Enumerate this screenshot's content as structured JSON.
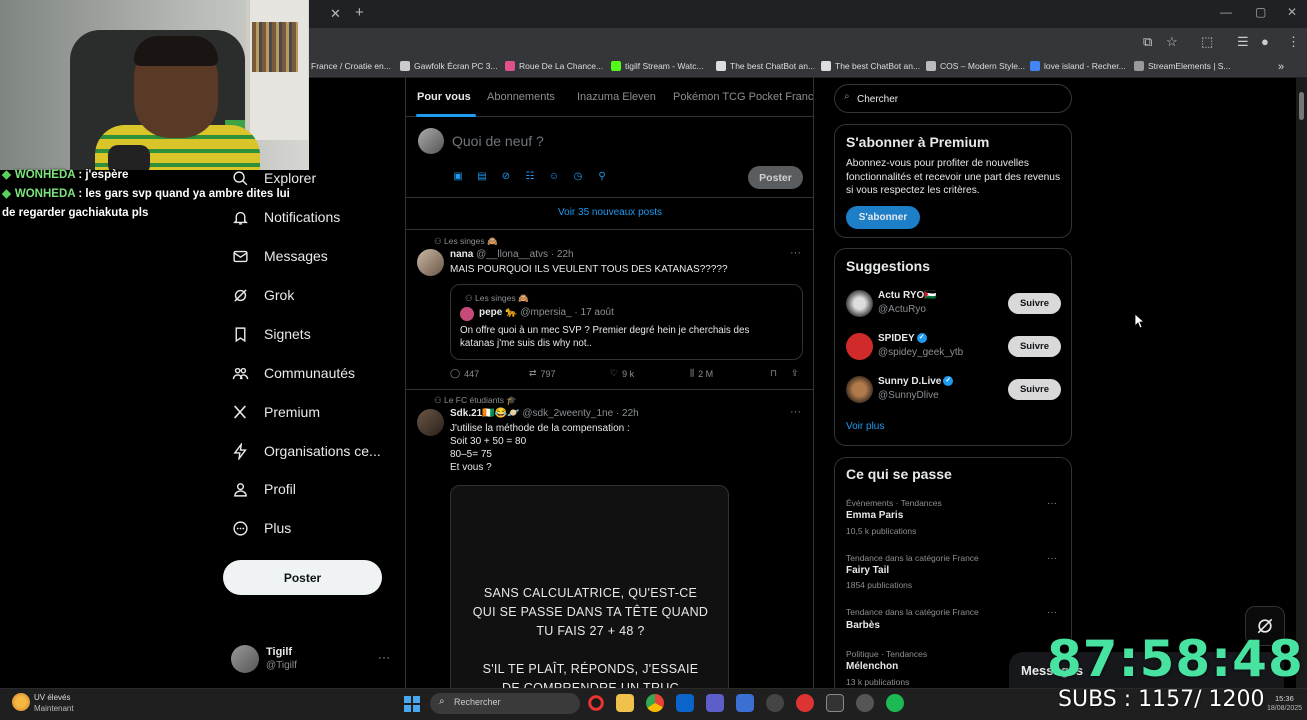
{
  "browser": {
    "bookmarks": [
      "France / Croatie en...",
      "Gawfolk Écran PC 3...",
      "Roue De La Chance...",
      "tigilf Stream - Watc...",
      "The best ChatBot an...",
      "The best ChatBot an...",
      "COS – Modern Style...",
      "love island - Recher...",
      "StreamElements | S..."
    ]
  },
  "stream_chat": [
    {
      "user": "WONHEDA",
      "text": " : j'espère"
    },
    {
      "user": "WONHEDA",
      "text": " : les gars svp quand ya ambre dites lui"
    },
    {
      "cont": "de regarder gachiakuta pls"
    }
  ],
  "sidebar": {
    "items": [
      {
        "label": "Explorer",
        "icon": "search-icon"
      },
      {
        "label": "Notifications",
        "icon": "bell-icon"
      },
      {
        "label": "Messages",
        "icon": "envelope-icon"
      },
      {
        "label": "Grok",
        "icon": "grok-icon"
      },
      {
        "label": "Signets",
        "icon": "bookmark-icon"
      },
      {
        "label": "Communautés",
        "icon": "people-icon"
      },
      {
        "label": "Premium",
        "icon": "x-logo-icon"
      },
      {
        "label": "Organisations ce...",
        "icon": "lightning-icon"
      },
      {
        "label": "Profil",
        "icon": "person-icon"
      },
      {
        "label": "Plus",
        "icon": "more-circle-icon"
      }
    ],
    "post_button": "Poster",
    "profile": {
      "name": "Tigilf",
      "handle": "@Tigilf",
      "more": "···"
    }
  },
  "feed": {
    "tabs": [
      "Pour vous",
      "Abonnements",
      "Inazuma Eleven",
      "Pokémon TCG Pocket France"
    ],
    "composer": {
      "placeholder": "Quoi de neuf ?",
      "post_button": "Poster"
    },
    "new_posts": "Voir 35 nouveaux posts",
    "posts": [
      {
        "community": "Les singes 🙈",
        "name": "nana",
        "meta": "@__llona__atvs · 22h",
        "text": "MAIS POURQUOI ILS VEULENT TOUS DES KATANAS?????",
        "quote": {
          "community": "Les singes 🙈",
          "name": "pepe 🐆",
          "meta": "@mpersia_ · 17 août",
          "text_line1": "On offre quoi à un mec SVP ? Premier degré hein je cherchais des",
          "text_line2": "katanas j'me suis dis why not.."
        },
        "stats": {
          "replies": "447",
          "reposts": "797",
          "likes": "9 k",
          "views": "2 M"
        }
      },
      {
        "community": "Le FC étudiants 🎓",
        "name": "Sdk.21🇨🇮😂🪐",
        "meta": "@sdk_2weenty_1ne · 22h",
        "lines": [
          "J'utilise la méthode de la compensation :",
          "Soit 30 + 50 = 80",
          "80–5= 75",
          "Et vous ?"
        ],
        "image_text": [
          "SANS CALCULATRICE, QU'EST-CE",
          "QUI SE PASSE DANS TA TÊTE QUAND",
          "TU FAIS 27 + 48 ?",
          "",
          "S'IL TE PLAÎT, RÉPONDS, J'ESSAIE",
          "DE COMPRENDRE UN TRUC"
        ]
      }
    ]
  },
  "right": {
    "search_placeholder": "Chercher",
    "premium": {
      "title": "S'abonner à Premium",
      "desc": "Abonnez-vous pour profiter de nouvelles fonctionnalités et recevoir une part des revenus si vous respectez les critères.",
      "button": "S'abonner"
    },
    "suggestions": {
      "title": "Suggestions",
      "users": [
        {
          "name": "Actu RYO🇵🇸",
          "handle": "@ActuRyo",
          "verified": false,
          "button": "Suivre"
        },
        {
          "name": "SPIDEY",
          "handle": "@spidey_geek_ytb",
          "verified": true,
          "button": "Suivre"
        },
        {
          "name": "Sunny D.Live",
          "handle": "@SunnyDlive",
          "verified": true,
          "button": "Suivre"
        }
      ],
      "see_more": "Voir plus"
    },
    "trends": {
      "title": "Ce qui se passe",
      "items": [
        {
          "cat": "Événements · Tendances",
          "name": "Emma Paris",
          "count": "10,5 k publications"
        },
        {
          "cat": "Tendance dans la catégorie France",
          "name": "Fairy Tail",
          "count": "1854 publications"
        },
        {
          "cat": "Tendance dans la catégorie France",
          "name": "Barbès",
          "count": ""
        },
        {
          "cat": "Politique · Tendances",
          "name": "Mélenchon",
          "count": "13 k publications"
        }
      ]
    }
  },
  "overlay": {
    "messages_drawer": "Messages",
    "timer": "87:58:48",
    "subs": "SUBS : 1157/ 1200"
  },
  "taskbar": {
    "weather_line1": "UV élevés",
    "weather_line2": "Maintenant",
    "search_placeholder": "Rechercher",
    "time": "15:36",
    "date": "18/08/2025"
  }
}
